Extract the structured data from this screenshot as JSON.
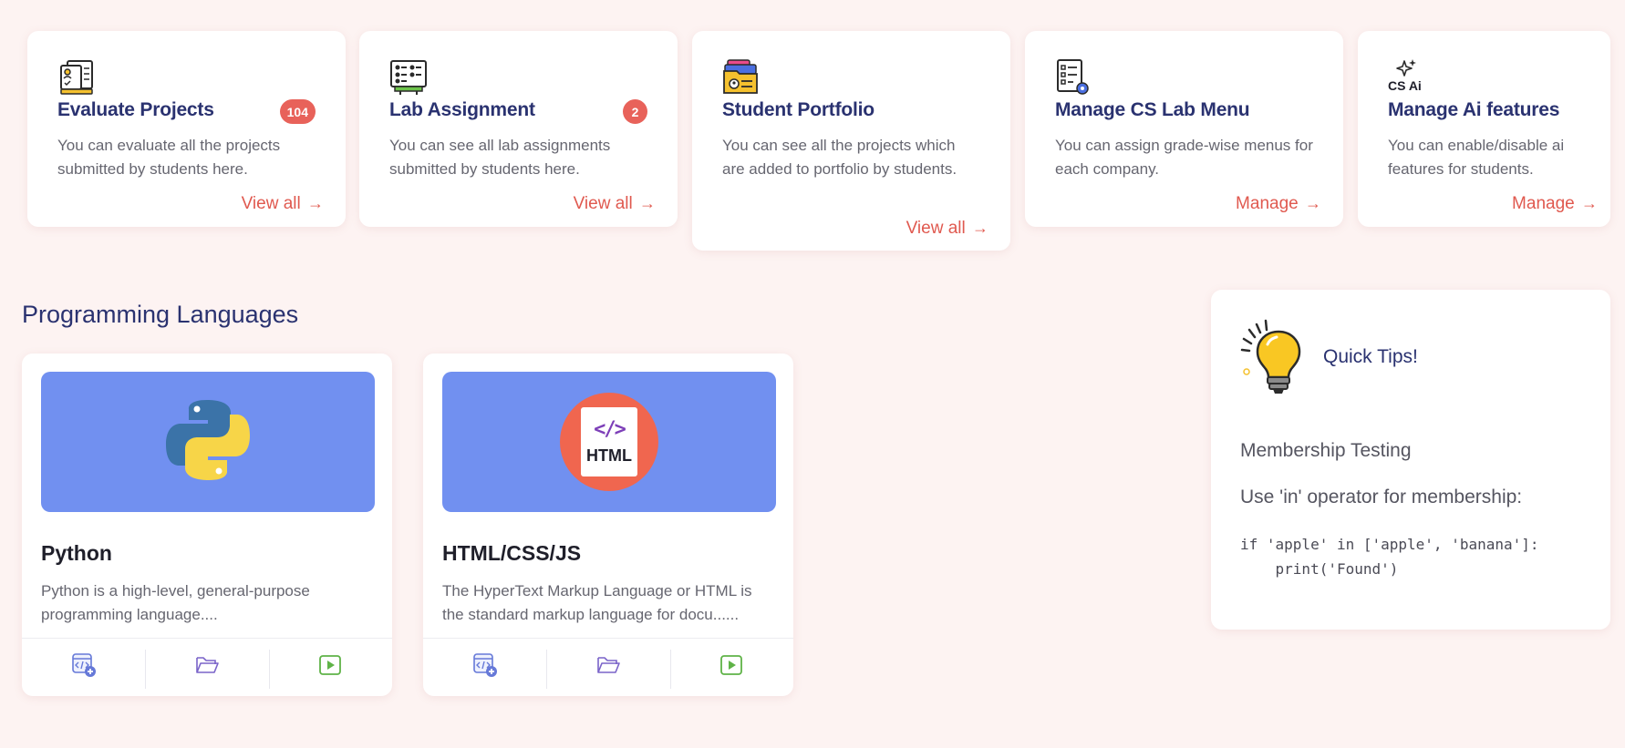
{
  "cards": [
    {
      "title": "Evaluate Projects",
      "badge": "104",
      "desc": "You can evaluate all the projects submitted by students here.",
      "link": "View all",
      "icon": "evaluate-projects-icon"
    },
    {
      "title": "Lab Assignment",
      "badge": "2",
      "desc": "You can see all lab assignments submitted by students here.",
      "link": "View all",
      "icon": "lab-assignment-icon"
    },
    {
      "title": "Student Portfolio",
      "desc": "You can see all the projects which are added to portfolio by students.",
      "link": "View all",
      "icon": "portfolio-folder-icon"
    },
    {
      "title": "Manage CS Lab Menu",
      "desc": "You can assign grade-wise menus for each company.",
      "link": "Manage",
      "icon": "menu-settings-icon"
    },
    {
      "title": "Manage Ai features",
      "icon_label": "CS Ai",
      "desc": "You can enable/disable ai features for students.",
      "link": "Manage",
      "icon": "cs-ai-sparkle-icon"
    }
  ],
  "arrow": "→",
  "section_title": "Programming Languages",
  "languages": [
    {
      "title": "Python",
      "desc": "Python is a high-level, general-purpose programming language....",
      "icon": "python-logo-icon"
    },
    {
      "title": "HTML/CSS/JS",
      "desc": "The HyperText Markup Language or HTML is the standard markup language for docu......",
      "icon_label": "HTML",
      "icon_code": "</>",
      "icon": "html-file-icon"
    }
  ],
  "footer_icons": [
    "new-code-file-icon",
    "folder-open-icon",
    "play-video-icon"
  ],
  "tips": {
    "title": "Quick Tips!",
    "heading": "Membership Testing",
    "text": "Use 'in' operator for membership:",
    "code": "if 'apple' in ['apple', 'banana']:\n    print('Found')"
  },
  "colors": {
    "background": "#fdf3f2",
    "accent": "#e0594f",
    "title": "#2a3270",
    "banner": "#7190f0"
  }
}
